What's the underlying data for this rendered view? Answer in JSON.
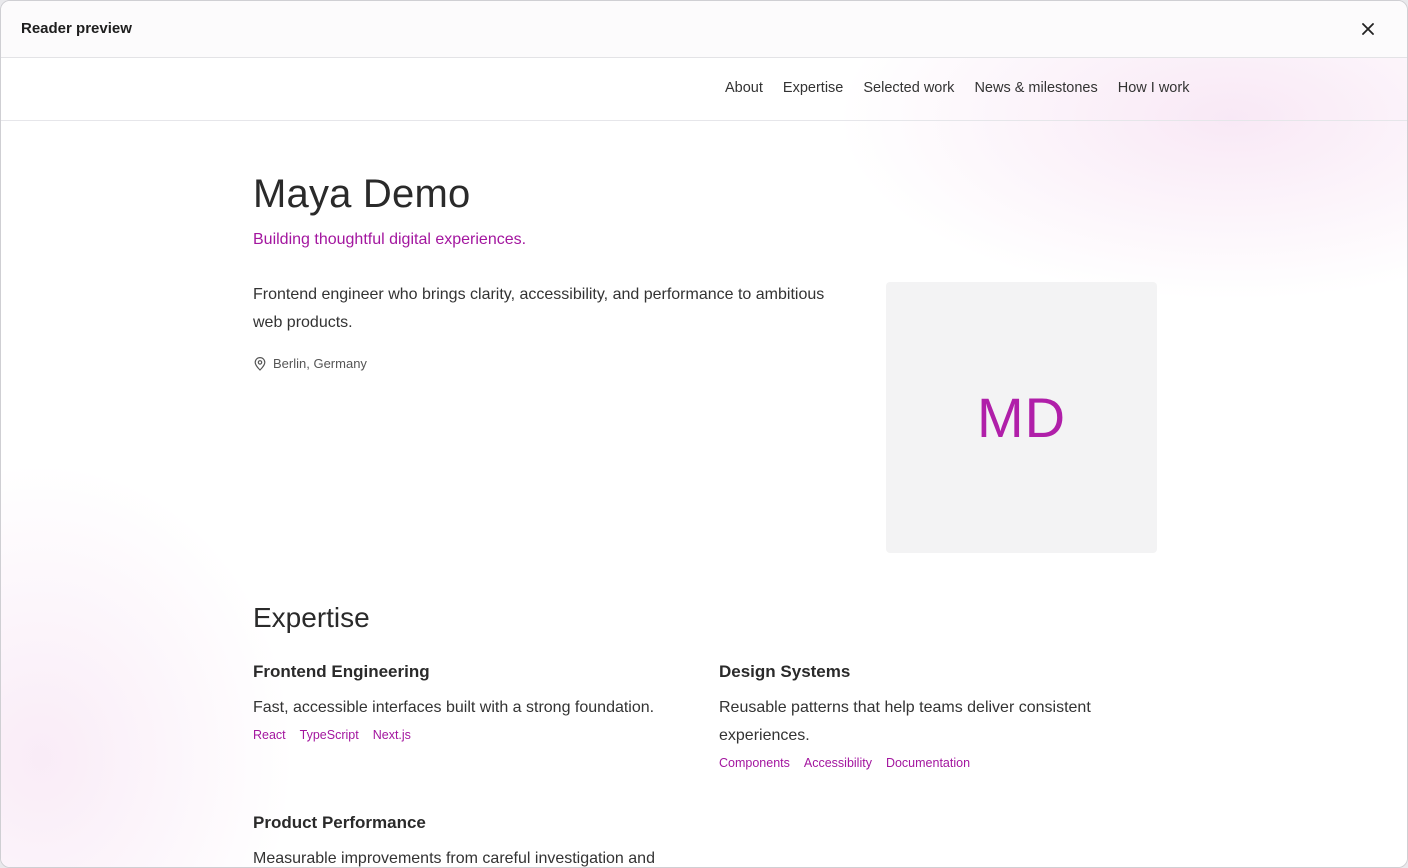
{
  "window": {
    "title": "Reader preview",
    "close_icon": "close-icon"
  },
  "nav": {
    "links": [
      "About",
      "Expertise",
      "Selected work",
      "News & milestones",
      "How I work"
    ]
  },
  "hero": {
    "name": "Maya Demo",
    "tagline": "Building thoughtful digital experiences.",
    "bio": "Frontend engineer who brings clarity, accessibility, and performance to ambitious web products.",
    "location": "Berlin, Germany",
    "location_icon": "map-pin-icon",
    "avatar_initials": "MD"
  },
  "expertise": {
    "title": "Expertise",
    "items": [
      {
        "title": "Frontend Engineering",
        "description": "Fast, accessible interfaces built with a strong foundation.",
        "tags": [
          "React",
          "TypeScript",
          "Next.js"
        ]
      },
      {
        "title": "Design Systems",
        "description": "Reusable patterns that help teams deliver consistent experiences.",
        "tags": [
          "Components",
          "Accessibility",
          "Documentation"
        ]
      },
      {
        "title": "Product Performance",
        "description": "Measurable improvements from careful investigation and"
      }
    ]
  },
  "colors": {
    "accent": "#a3169f",
    "avatar_bg": "#f3f3f4"
  }
}
